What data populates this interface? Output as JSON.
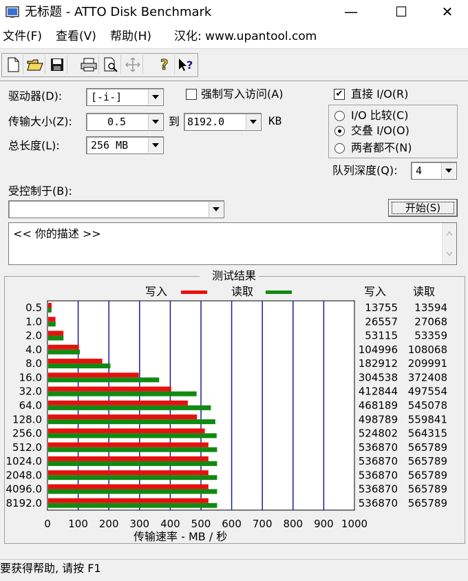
{
  "window": {
    "title": "无标题 - ATTO Disk Benchmark",
    "minimize": "—",
    "maximize": "☐",
    "close": "✕"
  },
  "menu": {
    "file": "文件(F)",
    "view": "查看(V)",
    "help": "帮助(H)",
    "hanhua": "汉化: www.upantool.com"
  },
  "toolbar": {
    "icons": [
      "new-file-icon",
      "open-folder-icon",
      "save-icon",
      "print-icon",
      "print-preview-icon",
      "move-icon",
      "help-icon",
      "context-help-icon"
    ]
  },
  "settings": {
    "drive_label": "驱动器(D):",
    "drive_value": "[-i-]",
    "transfer_label": "传输大小(Z):",
    "transfer_from": "0.5",
    "to_label": "到",
    "transfer_to": "8192.0",
    "kb_label": "KB",
    "total_label": "总长度(L):",
    "total_value": "256 MB",
    "force_write_label": "强制写入访问(A)",
    "force_write_checked": false,
    "direct_io_label": "直接 I/O(R)",
    "direct_io_checked": true,
    "io_compare_label": "I/O 比较(C)",
    "overlap_label": "交叠 I/O(O)",
    "neither_label": "两者都不(N)",
    "io_mode_selected": "overlap",
    "queue_label": "队列深度(Q):",
    "queue_value": "4",
    "controlled_label": "受控制于(B):",
    "controlled_value": "",
    "start_button": "开始(S)",
    "description": "<<  你的描述   >>"
  },
  "results": {
    "title": "测试结果",
    "write_legend": "写入",
    "read_legend": "读取",
    "write_header": "写入",
    "read_header": "读取",
    "xlabel": "传输速率 - MB / 秒",
    "write_color": "#e8100f",
    "read_color": "#118a11",
    "grid_color": "#1a1aa0"
  },
  "chart_data": {
    "type": "bar",
    "orientation": "horizontal",
    "title": "测试结果",
    "xlabel": "传输速率 - MB / 秒",
    "ylabel": "",
    "xlim": [
      0,
      1000
    ],
    "xticks": [
      0,
      100,
      200,
      300,
      400,
      500,
      600,
      700,
      800,
      900,
      1000
    ],
    "categories": [
      "0.5",
      "1.0",
      "2.0",
      "4.0",
      "8.0",
      "16.0",
      "32.0",
      "64.0",
      "128.0",
      "256.0",
      "512.0",
      "1024.0",
      "2048.0",
      "4096.0",
      "8192.0"
    ],
    "series": [
      {
        "name": "写入",
        "color": "#e8100f",
        "values_kb": [
          13755,
          26557,
          53115,
          104996,
          182912,
          304538,
          412844,
          468189,
          498789,
          524802,
          536870,
          536870,
          536870,
          536870,
          536870
        ]
      },
      {
        "name": "读取",
        "color": "#118a11",
        "values_kb": [
          13594,
          27068,
          53359,
          108068,
          209991,
          372408,
          497554,
          545078,
          559841,
          564315,
          565789,
          565789,
          565789,
          565789,
          565789
        ]
      }
    ],
    "legend": "top",
    "grid": true
  },
  "status": {
    "text": "要获得帮助, 请按 F1"
  }
}
